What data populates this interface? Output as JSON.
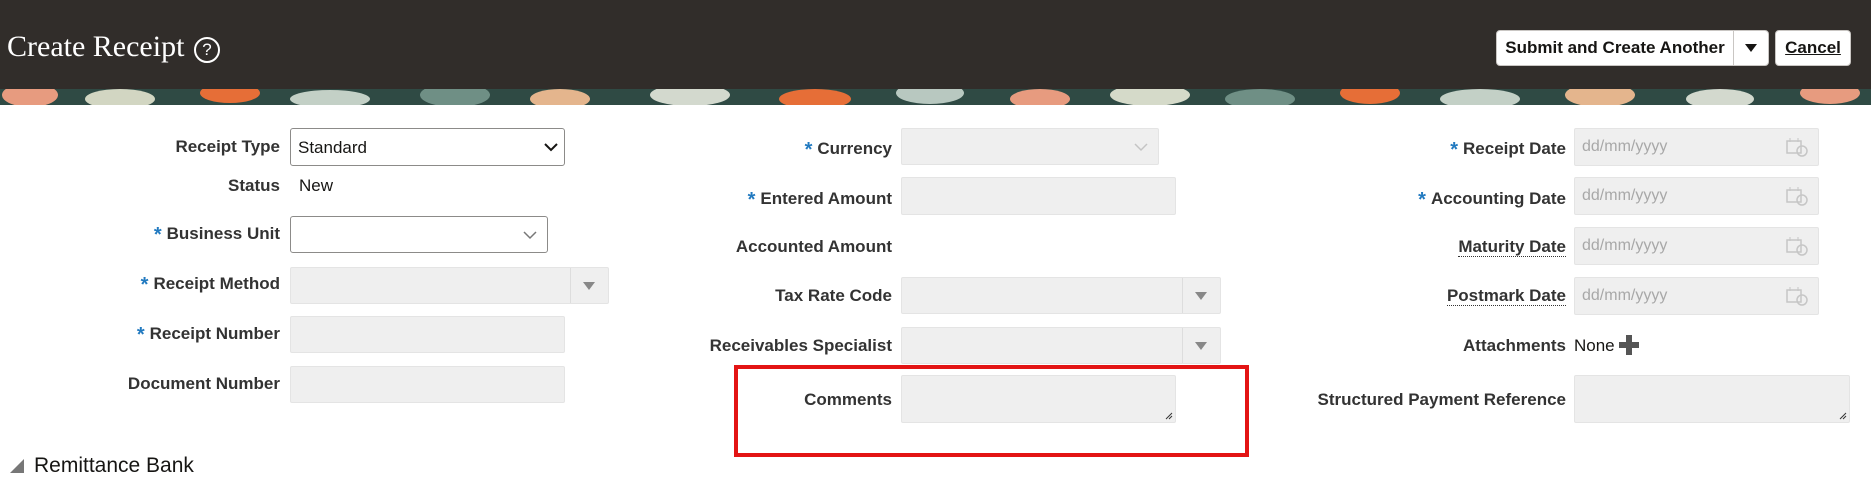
{
  "header": {
    "title": "Create Receipt",
    "help_icon": "?",
    "submit_label": "Submit and Create Another",
    "cancel_label": "Cancel"
  },
  "left": {
    "receipt_type_label": "Receipt Type",
    "receipt_type_value": "Standard",
    "status_label": "Status",
    "status_value": "New",
    "business_unit_label": "Business Unit",
    "receipt_method_label": "Receipt Method",
    "receipt_number_label": "Receipt Number",
    "document_number_label": "Document Number"
  },
  "middle": {
    "currency_label": "Currency",
    "entered_amount_label": "Entered Amount",
    "accounted_amount_label": "Accounted Amount",
    "tax_rate_code_label": "Tax Rate Code",
    "receivables_specialist_label": "Receivables Specialist",
    "comments_label": "Comments"
  },
  "right": {
    "receipt_date_label": "Receipt Date",
    "accounting_date_label": "Accounting Date",
    "maturity_date_label": "Maturity Date",
    "postmark_date_label": "Postmark Date",
    "date_placeholder": "dd/mm/yyyy",
    "attachments_label": "Attachments",
    "attachments_value": "None",
    "structured_payment_reference_label": "Structured Payment Reference"
  },
  "section": {
    "remittance_bank_label": "Remittance Bank"
  },
  "colors": {
    "header_bg": "#312d2a",
    "required_star": "#227ac0",
    "highlight_box": "#e31414"
  }
}
